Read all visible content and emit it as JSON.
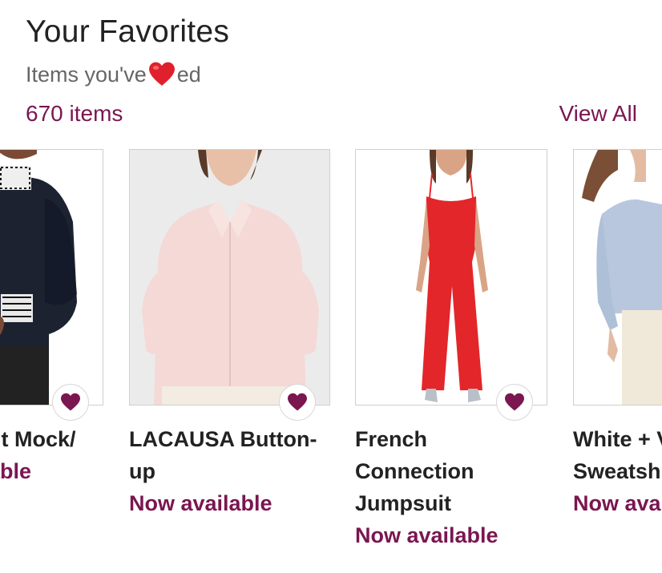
{
  "header": {
    "title": "Your Favorites",
    "subtitle_before": "Items you've",
    "subtitle_after": "ed",
    "subtitle_emoji": "red-heart-icon",
    "count": "670 items",
    "view_all": "View All"
  },
  "colors": {
    "accent": "#7a1650",
    "text": "#222222",
    "muted": "#666666"
  },
  "items": [
    {
      "name_line1": "ent Mock/",
      "name_line2": "",
      "availability": "ilable",
      "favorited": true
    },
    {
      "name_line1": "LACAUSA Button-",
      "name_line2": "up",
      "availability": "Now available",
      "favorited": true
    },
    {
      "name_line1": "French",
      "name_line2": "Connection",
      "name_line3": "Jumpsuit",
      "availability": "Now available",
      "favorited": true
    },
    {
      "name_line1": "White + V",
      "name_line2": "Sweatsh",
      "availability": "Now ava",
      "favorited": false
    }
  ]
}
